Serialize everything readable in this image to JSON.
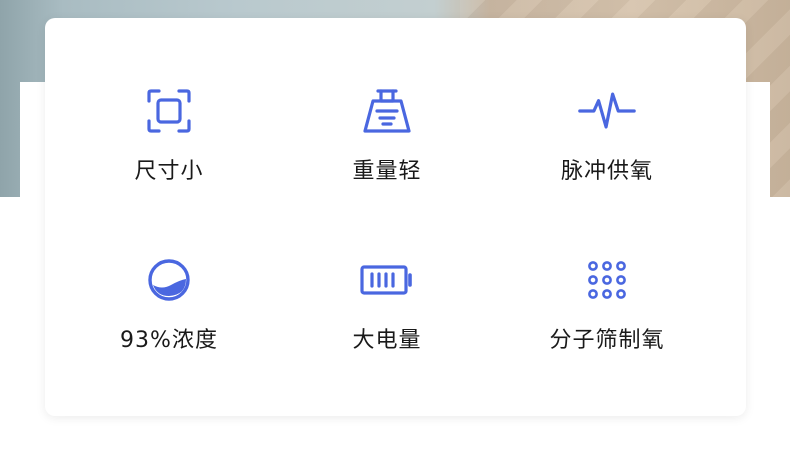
{
  "accent_color": "#4a67e0",
  "features": [
    {
      "label": "尺寸小",
      "icon": "focus-frame-icon"
    },
    {
      "label": "重量轻",
      "icon": "weight-icon"
    },
    {
      "label": "脉冲供氧",
      "icon": "pulse-icon"
    },
    {
      "label": "93%浓度",
      "icon": "concentration-gauge-icon"
    },
    {
      "label": "大电量",
      "icon": "battery-icon"
    },
    {
      "label": "分子筛制氧",
      "icon": "molecular-sieve-icon"
    }
  ]
}
